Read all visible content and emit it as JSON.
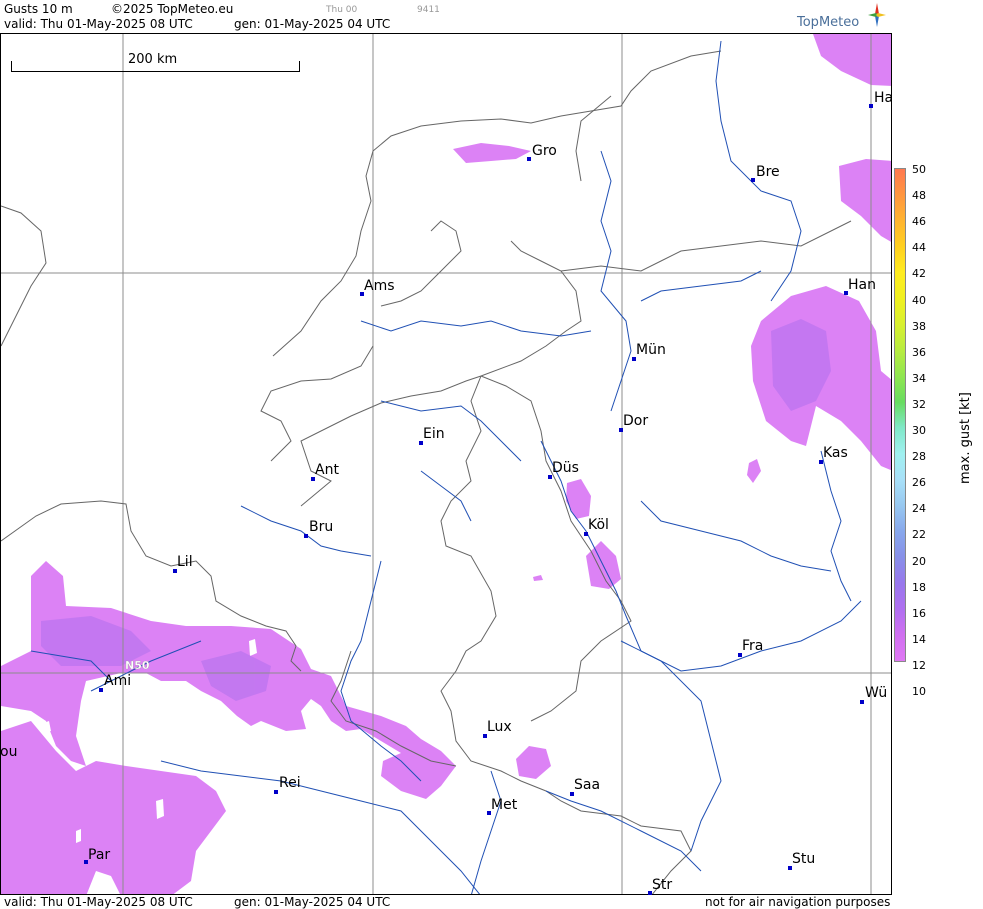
{
  "header": {
    "product": "Gusts 10 m",
    "copyright": "©2025 TopMeteo.eu",
    "small_run": "Thu 00",
    "small_code": "9411",
    "valid_line": "valid:  Thu  01-May-2025  08 UTC",
    "gen_line": "gen: 01-May-2025 04 UTC"
  },
  "logo": {
    "text": "TopMeteo"
  },
  "scale": {
    "label": "200 km"
  },
  "grid_label": "N50",
  "cities": [
    {
      "name": "Gro"
    },
    {
      "name": "Bre"
    },
    {
      "name": "Ha"
    },
    {
      "name": "Ams"
    },
    {
      "name": "Han"
    },
    {
      "name": "Mün"
    },
    {
      "name": "Dor"
    },
    {
      "name": "Ein"
    },
    {
      "name": "Düs"
    },
    {
      "name": "Kas"
    },
    {
      "name": "Ant"
    },
    {
      "name": "Köl"
    },
    {
      "name": "Bru"
    },
    {
      "name": "Lil"
    },
    {
      "name": "Fra"
    },
    {
      "name": "Ami"
    },
    {
      "name": "Wü"
    },
    {
      "name": "Lux"
    },
    {
      "name": "Rei"
    },
    {
      "name": "Saa"
    },
    {
      "name": "Met"
    },
    {
      "name": "Par"
    },
    {
      "name": "Stu"
    },
    {
      "name": "Str"
    },
    {
      "name": "ou"
    }
  ],
  "legend": {
    "title": "max. gust [kt]",
    "ticks": [
      "50",
      "48",
      "46",
      "44",
      "42",
      "40",
      "38",
      "36",
      "34",
      "32",
      "30",
      "28",
      "26",
      "24",
      "22",
      "20",
      "18",
      "16",
      "14",
      "12",
      "10"
    ],
    "colors": [
      "#ff7850",
      "#ff9640",
      "#ffb430",
      "#ffd020",
      "#ffec20",
      "#f0f020",
      "#d8f030",
      "#b8ec40",
      "#90e650",
      "#68dc60",
      "#80e8c8",
      "#a0f0f0",
      "#a8e0f8",
      "#98c8f0",
      "#88a8ec",
      "#8890e8",
      "#9878ec",
      "#b070f0",
      "#d070f0",
      "#e078f4"
    ]
  },
  "footer": {
    "valid_line": "valid:  Thu  01-May-2025  08 UTC",
    "gen_line": "gen: 01-May-2025 04 UTC",
    "disclaimer": "not for air navigation purposes"
  }
}
